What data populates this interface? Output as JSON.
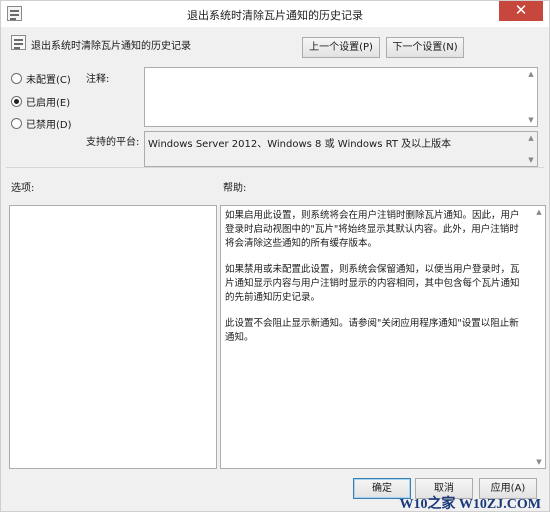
{
  "window": {
    "title": "退出系统时清除瓦片通知的历史记录",
    "close_glyph": "✕"
  },
  "policy": {
    "title": "退出系统时清除瓦片通知的历史记录",
    "prev_label": "上一个设置(P)",
    "next_label": "下一个设置(N)"
  },
  "radios": [
    {
      "label": "未配置(C)",
      "checked": false
    },
    {
      "label": "已启用(E)",
      "checked": true
    },
    {
      "label": "已禁用(D)",
      "checked": false
    }
  ],
  "comment": {
    "label": "注释:",
    "value": ""
  },
  "platform": {
    "label": "支持的平台:",
    "value": "Windows Server 2012、Windows 8 或 Windows RT 及以上版本"
  },
  "options": {
    "label": "选项:"
  },
  "help": {
    "label": "帮助:",
    "paragraphs": [
      "如果启用此设置，则系统将会在用户注销时删除瓦片通知。因此，用户登录时启动视图中的\"瓦片\"将始终显示其默认内容。此外，用户注销时将会清除这些通知的所有缓存版本。",
      "如果禁用或未配置此设置，则系统会保留通知，以便当用户登录时，瓦片通知显示内容与用户注销时显示的内容相同，其中包含每个瓦片通知的先前通知历史记录。",
      "此设置不会阻止显示新通知。请参阅\"关闭应用程序通知\"设置以阻止新通知。"
    ]
  },
  "footer": {
    "ok_label": "确定",
    "cancel_label": "取消",
    "apply_label": "应用(A)"
  },
  "watermark": "W10之家 W10ZJ.COM",
  "colors": {
    "close_button": "#c7473c",
    "primary_border": "#3c7fb1",
    "watermark": "#1b3a7a"
  }
}
